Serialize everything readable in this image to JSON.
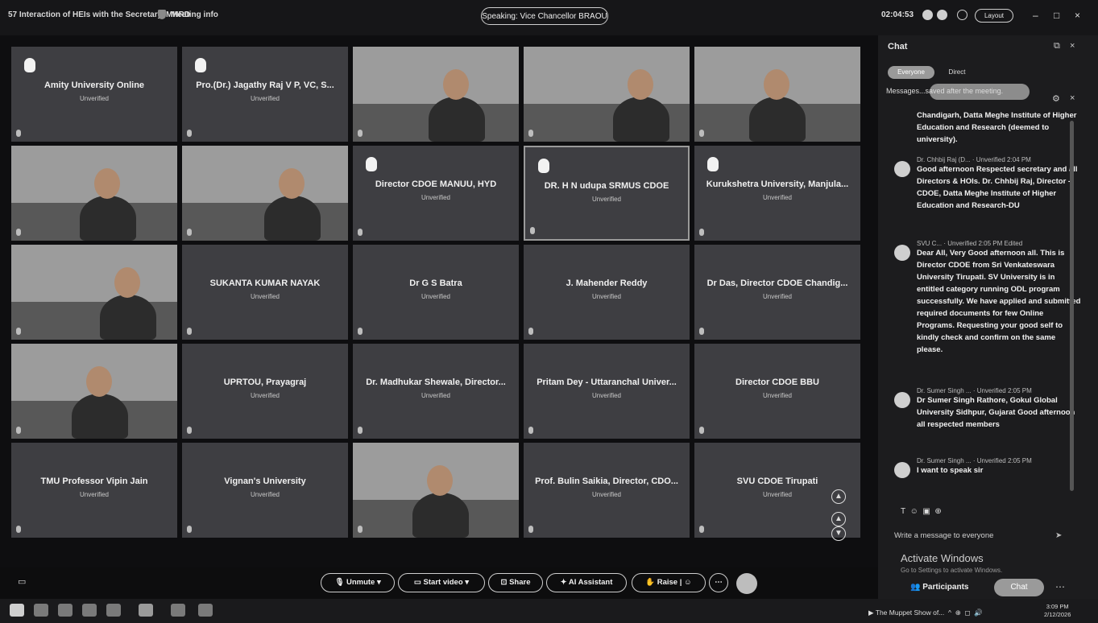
{
  "topbar": {
    "title": "57 Interaction of HEIs with the Secretary, MHRD",
    "meeting_info": "Meeting info",
    "speaking": "Speaking: Vice Chancellor BRAOU",
    "timer": "02:04:53",
    "layout": "Layout"
  },
  "tiles": [
    {
      "name": "Amity University Online",
      "status": "Unverified",
      "hand": true
    },
    {
      "name": "Pro.(Dr.) Jagathy Raj V P, VC, S...",
      "status": "Unverified",
      "hand": true
    },
    {
      "video": true
    },
    {
      "video": true
    },
    {
      "video": true
    },
    {
      "video": true
    },
    {
      "video": true
    },
    {
      "name": "Director CDOE MANUU, HYD",
      "status": "Unverified",
      "hand": true
    },
    {
      "name": "DR. H N udupa SRMUS CDOE",
      "status": "Unverified",
      "hand": true,
      "active": true
    },
    {
      "name": "Kurukshetra University, Manjula...",
      "status": "Unverified",
      "hand": true
    },
    {
      "video": true
    },
    {
      "name": "SUKANTA KUMAR NAYAK",
      "status": "Unverified"
    },
    {
      "name": "Dr G S Batra",
      "status": "Unverified"
    },
    {
      "name": "J. Mahender Reddy",
      "status": "Unverified"
    },
    {
      "name": "Dr Das, Director CDOE Chandig...",
      "status": "Unverified"
    },
    {
      "video": true
    },
    {
      "name": "UPRTOU, Prayagraj",
      "status": "Unverified"
    },
    {
      "name": "Dr. Madhukar Shewale, Director...",
      "status": "Unverified"
    },
    {
      "name": "Pritam Dey - Uttaranchal Univer...",
      "status": "Unverified"
    },
    {
      "name": "Director CDOE BBU",
      "status": "Unverified"
    },
    {
      "name": "TMU Professor Vipin Jain",
      "status": "Unverified"
    },
    {
      "name": "Vignan's University",
      "status": "Unverified"
    },
    {
      "video": true
    },
    {
      "name": "Prof. Bulin Saikia, Director, CDO...",
      "status": "Unverified"
    },
    {
      "name": "SVU CDOE Tirupati",
      "status": "Unverified"
    }
  ],
  "chat": {
    "title": "Chat",
    "tab_everyone": "Everyone",
    "tab_direct": "Direct",
    "saved_notice": "Messages...saved after the meeting.",
    "top_fragment": "Chandigarh, Datta Meghe Institute of Higher Education and Research (deemed to university).",
    "messages": [
      {
        "sender": "Dr. Chhbij Raj (D...",
        "badge": "Unverified",
        "time": "2:04 PM",
        "text": "Good afternoon Respected secretary and all Directors & HOIs. Dr. Chhbij Raj, Director - CDOE, Datta Meghe Institute of Higher Education and Research-DU"
      },
      {
        "sender": "SVU C...",
        "badge": "Unverified",
        "time": "2:05 PM  Edited",
        "text": "Dear All, Very Good afternoon all. This is Director CDOE from Sri Venkateswara University Tirupati. SV University is in entitled category running ODL program successfully. We have applied and submitted required documents for few Online Programs. Requesting your good self to kindly check and confirm on the same please."
      },
      {
        "sender": "Dr. Sumer Singh ...",
        "badge": "Unverified",
        "time": "2:05 PM",
        "text": "Dr Sumer Singh Rathore, Gokul Global University Sidhpur, Gujarat Good afternoon all respected members"
      },
      {
        "sender": "Dr. Sumer Singh ...",
        "badge": "Unverified",
        "time": "2:05 PM",
        "text": "I want to speak sir"
      }
    ],
    "compose_placeholder": "Write a message to everyone",
    "participants": "Participants",
    "chat_button": "Chat"
  },
  "watermark": {
    "title": "Activate Windows",
    "sub": "Go to Settings to activate Windows."
  },
  "toolbar": {
    "unmute": "Unmute",
    "start_video": "Start video",
    "share": "Share",
    "ai_assistant": "AI Assistant",
    "raise": "Raise"
  },
  "taskbar": {
    "now_playing": "The Muppet Show of...",
    "time": "3:09 PM",
    "date": "2/12/2026"
  }
}
